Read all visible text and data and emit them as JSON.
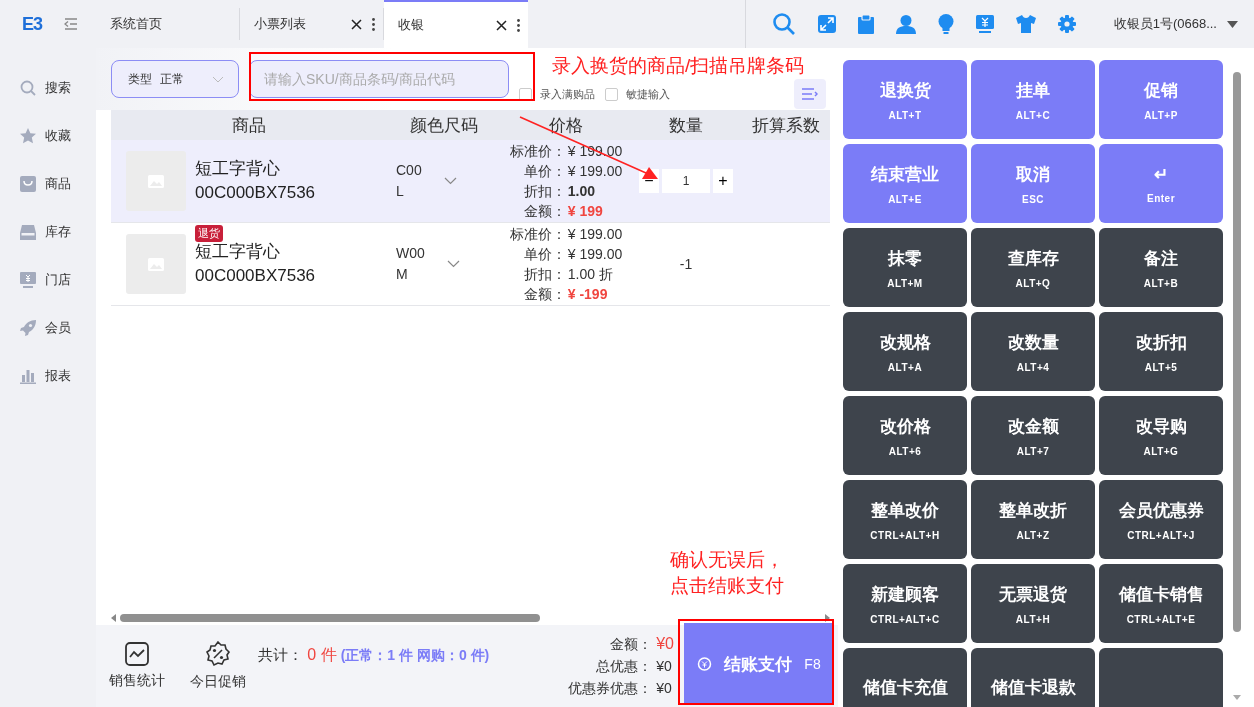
{
  "logo": "E3",
  "tabs": [
    {
      "label": "系统首页",
      "selected": false,
      "closable": false
    },
    {
      "label": "小票列表",
      "selected": false,
      "closable": true
    },
    {
      "label": "收银",
      "selected": true,
      "closable": true
    }
  ],
  "user": {
    "name": "收银员1号(0668..."
  },
  "sidebar": {
    "items": [
      {
        "label": "搜索"
      },
      {
        "label": "收藏"
      },
      {
        "label": "商品"
      },
      {
        "label": "库存"
      },
      {
        "label": "门店"
      },
      {
        "label": "会员"
      },
      {
        "label": "报表"
      }
    ]
  },
  "order_type": {
    "label": "类型",
    "value": "正常"
  },
  "search": {
    "placeholder": "请输入SKU/商品条码/商品代码"
  },
  "options": [
    {
      "label": "录入满购品",
      "checked": false
    },
    {
      "label": "敏捷输入",
      "checked": false
    }
  ],
  "table": {
    "columns": [
      "商品",
      "颜色尺码",
      "价格",
      "数量",
      "折算系数"
    ],
    "rows": [
      {
        "selected": true,
        "tag": null,
        "name": "短工字背心",
        "code": "00C000BX7536",
        "variant": [
          "C00",
          "L"
        ],
        "kind": "stepper",
        "quantity": "1",
        "minus": "−",
        "plus": "+",
        "prices": [
          {
            "label": "标准价：",
            "value": "¥ 199.00",
            "kind": "plain"
          },
          {
            "label": "单价：",
            "value": "¥ 199.00",
            "kind": "plain"
          },
          {
            "label": "折扣：",
            "value": "1.00",
            "kind": "bold"
          },
          {
            "label": "金额：",
            "value": "¥ 199",
            "kind": "amount"
          }
        ]
      },
      {
        "selected": false,
        "tag": "退货",
        "name": "短工字背心",
        "code": "00C000BX7536",
        "variant": [
          "W00",
          "M"
        ],
        "kind": "plain",
        "quantity": "-1",
        "prices": [
          {
            "label": "标准价：",
            "value": "¥ 199.00",
            "kind": "plain"
          },
          {
            "label": "单价：",
            "value": "¥ 199.00",
            "kind": "plain"
          },
          {
            "label": "折扣：",
            "value": "1.00 折",
            "kind": "plain"
          },
          {
            "label": "金额：",
            "value": "¥ -199",
            "kind": "amount"
          }
        ]
      }
    ]
  },
  "footer": {
    "tools": [
      {
        "label": "销售统计"
      },
      {
        "label": "今日促销"
      }
    ],
    "total_label": "共计：",
    "total_count": "0 件",
    "breakdown": "(正常：1 件  网购：0 件)",
    "amounts": [
      {
        "label": "金额：",
        "value": "¥0",
        "kind": "highlight"
      },
      {
        "label": "总优惠：",
        "value": "¥0",
        "kind": "plain"
      },
      {
        "label": "优惠券优惠：",
        "value": "¥0",
        "kind": "plain"
      }
    ],
    "pay_button": {
      "label": "结账支付",
      "shortcut": "F8"
    }
  },
  "actions": [
    {
      "label": "退换货",
      "shortcut": "ALT+T",
      "kind": "primary"
    },
    {
      "label": "挂单",
      "shortcut": "ALT+C",
      "kind": "primary"
    },
    {
      "label": "促销",
      "shortcut": "ALT+P",
      "kind": "primary"
    },
    {
      "label": "结束营业",
      "shortcut": "ALT+E",
      "kind": "primary"
    },
    {
      "label": "取消",
      "shortcut": "ESC",
      "kind": "primary"
    },
    {
      "label": "↵",
      "shortcut": "Enter",
      "kind": "primary"
    },
    {
      "label": "抹零",
      "shortcut": "ALT+M",
      "kind": "dark"
    },
    {
      "label": "查库存",
      "shortcut": "ALT+Q",
      "kind": "dark"
    },
    {
      "label": "备注",
      "shortcut": "ALT+B",
      "kind": "dark"
    },
    {
      "label": "改规格",
      "shortcut": "ALT+A",
      "kind": "dark"
    },
    {
      "label": "改数量",
      "shortcut": "ALT+4",
      "kind": "dark"
    },
    {
      "label": "改折扣",
      "shortcut": "ALT+5",
      "kind": "dark"
    },
    {
      "label": "改价格",
      "shortcut": "ALT+6",
      "kind": "dark"
    },
    {
      "label": "改金额",
      "shortcut": "ALT+7",
      "kind": "dark"
    },
    {
      "label": "改导购",
      "shortcut": "ALT+G",
      "kind": "dark"
    },
    {
      "label": "整单改价",
      "shortcut": "CTRL+ALT+H",
      "kind": "dark"
    },
    {
      "label": "整单改折",
      "shortcut": "ALT+Z",
      "kind": "dark"
    },
    {
      "label": "会员优惠券",
      "shortcut": "CTRL+ALT+J",
      "kind": "dark"
    },
    {
      "label": "新建顾客",
      "shortcut": "CTRL+ALT+C",
      "kind": "dark"
    },
    {
      "label": "无票退货",
      "shortcut": "ALT+H",
      "kind": "dark"
    },
    {
      "label": "储值卡销售",
      "shortcut": "CTRL+ALT+E",
      "kind": "dark"
    },
    {
      "label": "储值卡充值",
      "kind": "dark"
    },
    {
      "label": "储值卡退款",
      "kind": "dark"
    },
    {
      "kind": "blank"
    }
  ],
  "annotations": [
    {
      "lines": [
        "录入换货的商品/扫描吊牌条码"
      ]
    },
    {
      "lines": [
        "确认无误后，",
        "点击结账支付"
      ]
    }
  ]
}
